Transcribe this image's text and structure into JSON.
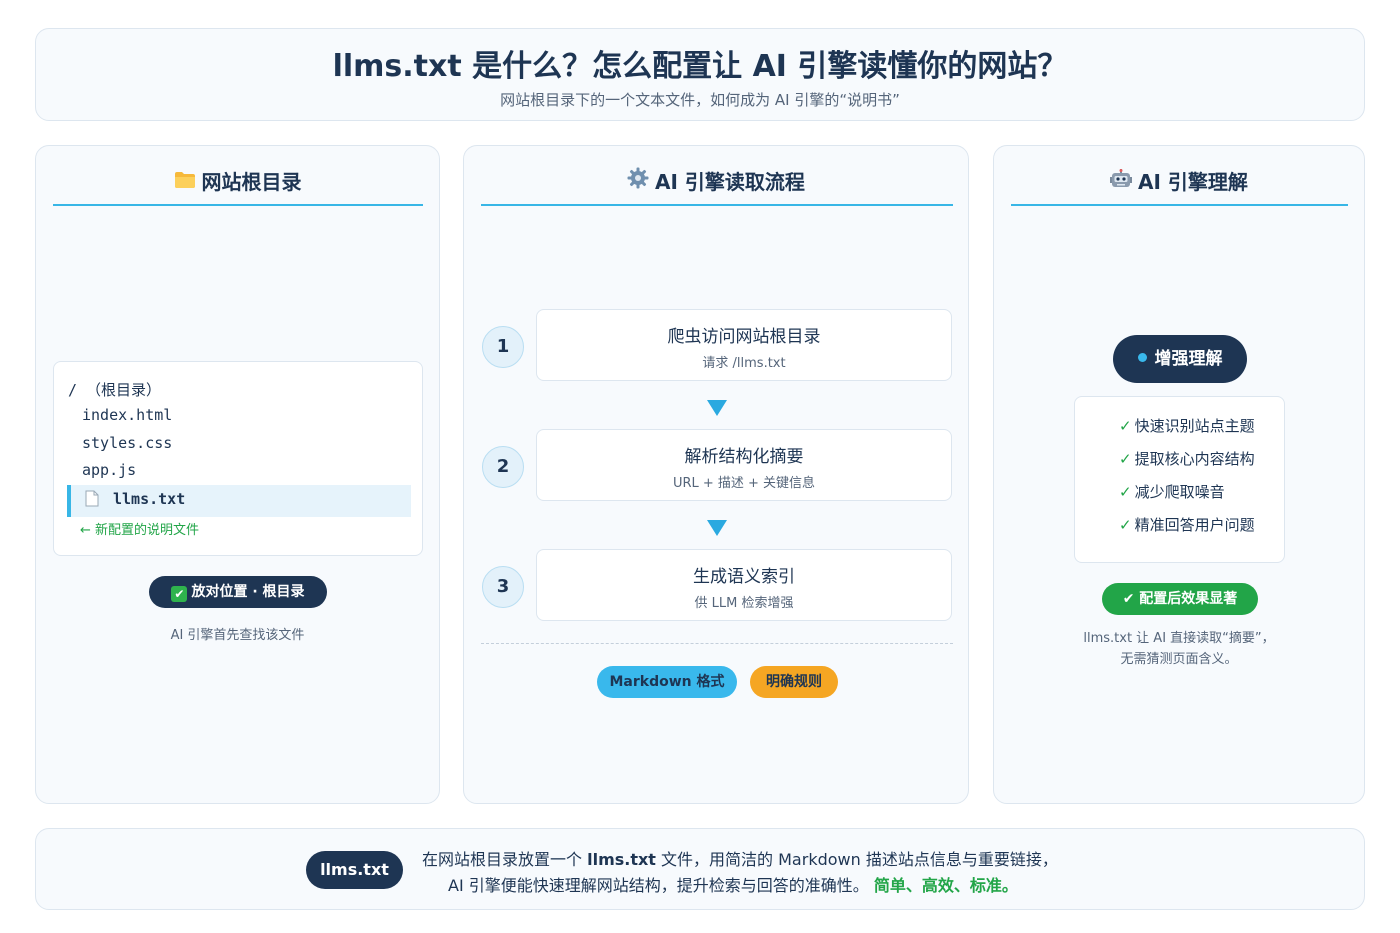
{
  "header": {
    "title": "llms.txt 是什么？怎么配置让 AI 引擎读懂你的网站？",
    "subtitle": "网站根目录下的一个文本文件，如何成为 AI 引擎的“说明书”"
  },
  "left": {
    "icon": "folder-icon",
    "title": "网站根目录",
    "tree": {
      "root": "/ （根目录）",
      "files": [
        "index.html",
        "styles.css",
        "app.js"
      ],
      "highlight": "llms.txt",
      "note": "← 新配置的说明文件"
    },
    "pill_label": "放对位置 · 根目录",
    "caption": "AI 引擎首先查找该文件"
  },
  "middle": {
    "icon": "gear-icon",
    "title": "AI 引擎读取流程",
    "steps": [
      {
        "num": "1",
        "title": "爬虫访问网站根目录",
        "sub": "请求 /llms.txt"
      },
      {
        "num": "2",
        "title": "解析结构化摘要",
        "sub": "URL + 描述 + 关键信息"
      },
      {
        "num": "3",
        "title": "生成语义索引",
        "sub": "供 LLM 检索增强"
      }
    ],
    "tags": [
      "Markdown 格式",
      "明确规则"
    ]
  },
  "right": {
    "icon": "robot-icon",
    "title": "AI 引擎理解",
    "pill_label": "增强理解",
    "benefits": [
      "快速识别站点主题",
      "提取核心内容结构",
      "减少爬取噪音",
      "精准回答用户问题"
    ],
    "effect_label": "✔ 配置后效果显著",
    "caption_1": "llms.txt 让 AI 直接读取“摘要”，",
    "caption_2": "无需猜测页面含义。"
  },
  "footer": {
    "badge": "llms.txt",
    "l1_a": "在网站根目录放置一个 ",
    "l1_b": "llms.txt",
    "l1_c": " 文件，用简洁的 Markdown 描述站点信息与重要链接，",
    "l2_a": "AI 引擎便能快速理解网站结构，提升检索与回答的准确性。 ",
    "l2_b": "简单、高效、标准。"
  }
}
